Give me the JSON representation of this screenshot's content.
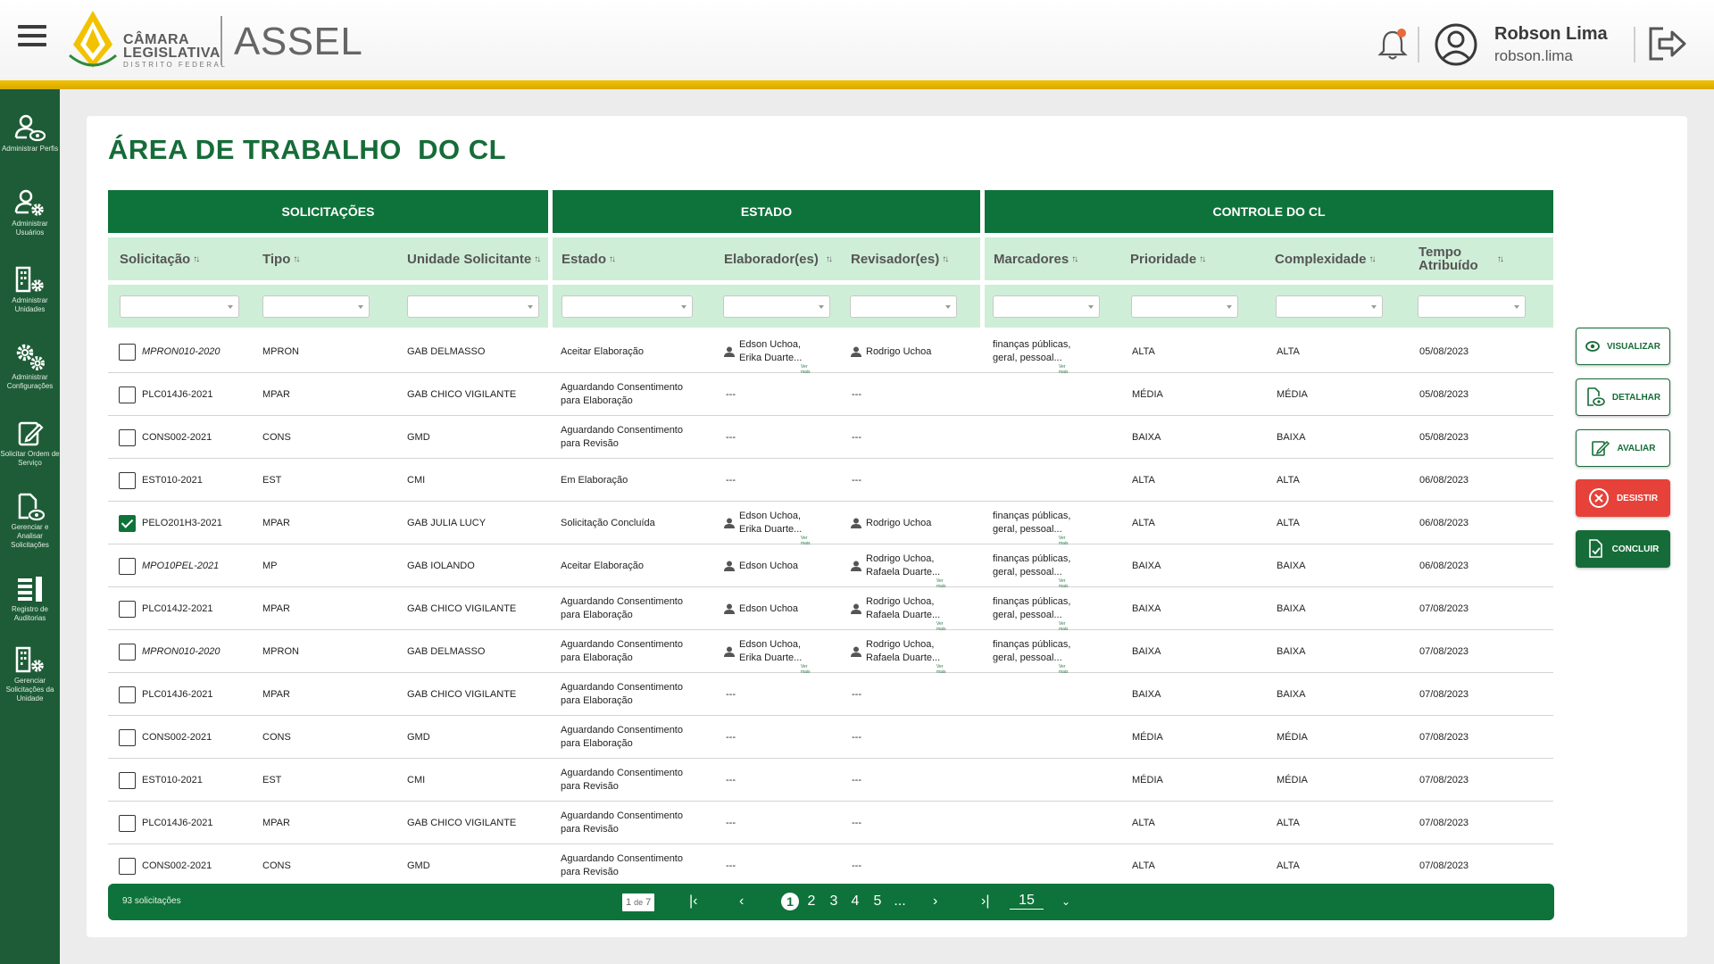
{
  "header": {
    "logo_line1": "CÂMARA",
    "logo_line2": "LEGISLATIVA",
    "logo_sub": "DISTRITO FEDERAL",
    "app_name": "ASSEL",
    "user_name": "Robson Lima",
    "user_login": "robson.lima"
  },
  "sidebar": {
    "items": [
      {
        "label": "Administrar Perfis",
        "icon": "user-eye-icon"
      },
      {
        "label": "Administrar Usuários",
        "icon": "user-gear-icon"
      },
      {
        "label": "Administrar Unidades",
        "icon": "building-gear-icon"
      },
      {
        "label": "Administrar Configurações",
        "icon": "gears-icon"
      },
      {
        "label": "Solicitar Ordem de Serviço",
        "icon": "edit-icon"
      },
      {
        "label": "Gerenciar e Analisar Solicitações",
        "icon": "doc-eye-icon"
      },
      {
        "label": "Registro de Auditorias",
        "icon": "audit-list-icon"
      },
      {
        "label": "Gerenciar Solicitações da Unidade",
        "icon": "building-gear-icon"
      }
    ]
  },
  "main": {
    "title": "ÁREA DE TRABALHO  DO CL",
    "groups": [
      "SOLICITAÇÕES",
      "ESTADO",
      "CONTROLE DO CL"
    ],
    "columns": [
      "Solicitação",
      "Tipo",
      "Unidade Solicitante",
      "Estado",
      "Elaborador(es)",
      "Revisador(es)",
      "Marcadores",
      "Prioridade",
      "Complexidade",
      "Tempo Atribuído"
    ],
    "ver_mais": "Ver mais",
    "rows": [
      {
        "solicitacao": "MPRON010-2020",
        "italic": true,
        "checked": false,
        "tipo": "MPRON",
        "unidade": "GAB DELMASSO",
        "estado1": "Aceitar Elaboração",
        "estado2": "",
        "elab1": "Edson Uchoa,",
        "elab2": "Erika Duarte...",
        "rev1": "Rodrigo Uchoa",
        "rev2": "",
        "marc1": "finanças públicas,",
        "marc2": "geral, pessoal...",
        "prioridade": "ALTA",
        "complexidade": "ALTA",
        "tempo": "05/08/2023"
      },
      {
        "solicitacao": "PLC014J6-2021",
        "italic": false,
        "checked": false,
        "tipo": "MPAR",
        "unidade": "GAB CHICO VIGILANTE",
        "estado1": "Aguardando Consentimento",
        "estado2": "para Elaboração",
        "elab1": "---",
        "elab2": "",
        "rev1": "---",
        "rev2": "",
        "marc1": "",
        "marc2": "",
        "prioridade": "MÉDIA",
        "complexidade": "MÉDIA",
        "tempo": "05/08/2023"
      },
      {
        "solicitacao": "CONS002-2021",
        "italic": false,
        "checked": false,
        "tipo": "CONS",
        "unidade": "GMD",
        "estado1": "Aguardando Consentimento",
        "estado2": "para Revisão",
        "elab1": "---",
        "elab2": "",
        "rev1": "---",
        "rev2": "",
        "marc1": "",
        "marc2": "",
        "prioridade": "BAIXA",
        "complexidade": "BAIXA",
        "tempo": "05/08/2023"
      },
      {
        "solicitacao": "EST010-2021",
        "italic": false,
        "checked": false,
        "tipo": "EST",
        "unidade": "CMI",
        "estado1": "Em Elaboração",
        "estado2": "",
        "elab1": "---",
        "elab2": "",
        "rev1": "---",
        "rev2": "",
        "marc1": "",
        "marc2": "",
        "prioridade": "ALTA",
        "complexidade": "ALTA",
        "tempo": "06/08/2023"
      },
      {
        "solicitacao": "PELO201H3-2021",
        "italic": false,
        "checked": true,
        "tipo": "MPAR",
        "unidade": "GAB JULIA LUCY",
        "estado1": "Solicitação Concluída",
        "estado2": "",
        "elab1": "Edson Uchoa,",
        "elab2": "Erika Duarte...",
        "rev1": "Rodrigo Uchoa",
        "rev2": "",
        "marc1": "finanças públicas,",
        "marc2": "geral, pessoal...",
        "prioridade": "ALTA",
        "complexidade": "ALTA",
        "tempo": "06/08/2023"
      },
      {
        "solicitacao": "MPO10PEL-2021",
        "italic": true,
        "checked": false,
        "tipo": "MP",
        "unidade": "GAB IOLANDO",
        "estado1": "Aceitar Elaboração",
        "estado2": "",
        "elab1": "Edson Uchoa",
        "elab2": "",
        "rev1": "Rodrigo Uchoa,",
        "rev2": "Rafaela Duarte...",
        "marc1": "finanças públicas,",
        "marc2": "geral, pessoal...",
        "prioridade": "BAIXA",
        "complexidade": "BAIXA",
        "tempo": "06/08/2023"
      },
      {
        "solicitacao": "PLC014J2-2021",
        "italic": false,
        "checked": false,
        "tipo": "MPAR",
        "unidade": "GAB CHICO VIGILANTE",
        "estado1": "Aguardando Consentimento",
        "estado2": "para Elaboração",
        "elab1": "Edson Uchoa",
        "elab2": "",
        "rev1": "Rodrigo Uchoa,",
        "rev2": "Rafaela Duarte...",
        "marc1": "finanças públicas,",
        "marc2": "geral, pessoal...",
        "prioridade": "BAIXA",
        "complexidade": "BAIXA",
        "tempo": "07/08/2023"
      },
      {
        "solicitacao": "MPRON010-2020",
        "italic": true,
        "checked": false,
        "tipo": "MPRON",
        "unidade": "GAB DELMASSO",
        "estado1": "Aguardando Consentimento",
        "estado2": "para Elaboração",
        "elab1": "Edson Uchoa,",
        "elab2": "Erika Duarte...",
        "rev1": "Rodrigo Uchoa,",
        "rev2": "Rafaela Duarte...",
        "marc1": "finanças públicas,",
        "marc2": "geral, pessoal...",
        "prioridade": "BAIXA",
        "complexidade": "BAIXA",
        "tempo": "07/08/2023"
      },
      {
        "solicitacao": "PLC014J6-2021",
        "italic": false,
        "checked": false,
        "tipo": "MPAR",
        "unidade": "GAB CHICO VIGILANTE",
        "estado1": "Aguardando Consentimento",
        "estado2": "para Elaboração",
        "elab1": "---",
        "elab2": "",
        "rev1": "---",
        "rev2": "",
        "marc1": "",
        "marc2": "",
        "prioridade": "BAIXA",
        "complexidade": "BAIXA",
        "tempo": "07/08/2023"
      },
      {
        "solicitacao": "CONS002-2021",
        "italic": false,
        "checked": false,
        "tipo": "CONS",
        "unidade": "GMD",
        "estado1": "Aguardando Consentimento",
        "estado2": "para Elaboração",
        "elab1": "---",
        "elab2": "",
        "rev1": "---",
        "rev2": "",
        "marc1": "",
        "marc2": "",
        "prioridade": "MÉDIA",
        "complexidade": "MÉDIA",
        "tempo": "07/08/2023"
      },
      {
        "solicitacao": "EST010-2021",
        "italic": false,
        "checked": false,
        "tipo": "EST",
        "unidade": "CMI",
        "estado1": "Aguardando Consentimento",
        "estado2": "para Revisão",
        "elab1": "---",
        "elab2": "",
        "rev1": "---",
        "rev2": "",
        "marc1": "",
        "marc2": "",
        "prioridade": "MÉDIA",
        "complexidade": "MÉDIA",
        "tempo": "07/08/2023"
      },
      {
        "solicitacao": "PLC014J6-2021",
        "italic": false,
        "checked": false,
        "tipo": "MPAR",
        "unidade": "GAB CHICO VIGILANTE",
        "estado1": "Aguardando Consentimento",
        "estado2": "para Revisão",
        "elab1": "---",
        "elab2": "",
        "rev1": "---",
        "rev2": "",
        "marc1": "",
        "marc2": "",
        "prioridade": "ALTA",
        "complexidade": "ALTA",
        "tempo": "07/08/2023"
      },
      {
        "solicitacao": "CONS002-2021",
        "italic": false,
        "checked": false,
        "tipo": "CONS",
        "unidade": "GMD",
        "estado1": "Aguardando Consentimento",
        "estado2": "para Revisão",
        "elab1": "---",
        "elab2": "",
        "rev1": "---",
        "rev2": "",
        "marc1": "",
        "marc2": "",
        "prioridade": "ALTA",
        "complexidade": "ALTA",
        "tempo": "07/08/2023"
      }
    ]
  },
  "actions": [
    {
      "label": "VISUALIZAR",
      "icon": "eye-icon",
      "style": "outline"
    },
    {
      "label": "DETALHAR",
      "icon": "doc-eye-icon",
      "style": "outline"
    },
    {
      "label": "AVALIAR",
      "icon": "edit-icon",
      "style": "outline"
    },
    {
      "label": "DESISTIR",
      "icon": "close-circle-icon",
      "style": "red"
    },
    {
      "label": "CONCLUIR",
      "icon": "doc-check-icon",
      "style": "green"
    }
  ],
  "footer": {
    "count": "93 solicitações",
    "page_current": "1",
    "page_sep": "de",
    "page_total": "7",
    "pages": [
      "1",
      "2",
      "3",
      "4",
      "5",
      "..."
    ],
    "per_page": "15"
  },
  "colors": {
    "primary": "#0e733a",
    "sidebar": "#1d5c36",
    "accent": "#f2c200",
    "header_band": "#cfeed7",
    "danger": "#e6423a"
  }
}
